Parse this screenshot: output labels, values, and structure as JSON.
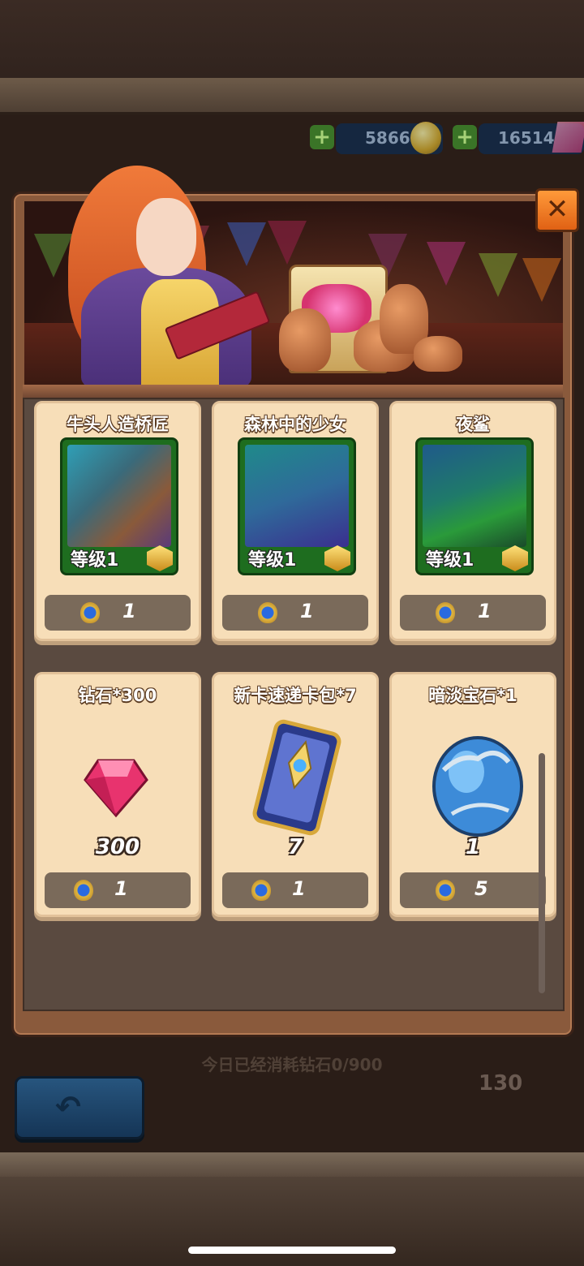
{
  "hud": {
    "gold": "5866",
    "gems": "16514"
  },
  "background": {
    "daily_info": "今日已经消耗钻石0/900",
    "count": "130"
  },
  "modal": {
    "close_label": "✕"
  },
  "shop_items": [
    {
      "title": "牛头人造桥匠",
      "kind": "hero",
      "level": "等级1",
      "price": "1",
      "art_colors": [
        "#2f9fb6",
        "#5a3a7a"
      ]
    },
    {
      "title": "森林中的少女",
      "kind": "hero",
      "level": "等级1",
      "price": "1",
      "art_colors": [
        "#1f8a8a",
        "#3a2f8f"
      ]
    },
    {
      "title": "夜鲨",
      "kind": "hero",
      "level": "等级1",
      "price": "1",
      "art_colors": [
        "#1f5a8a",
        "#2a7a4a"
      ]
    },
    {
      "title": "钻石*300",
      "kind": "item",
      "quantity": "300",
      "price": "1",
      "icon": "gem-icon"
    },
    {
      "title": "新卡速递卡包*7",
      "kind": "item",
      "quantity": "7",
      "price": "1",
      "icon": "card-pack-icon"
    },
    {
      "title": "暗淡宝石*1",
      "kind": "item",
      "quantity": "1",
      "price": "5",
      "icon": "egg-stone-icon"
    }
  ],
  "colors": {
    "card_bg": "#f7deb8",
    "price_bar": "#7a6a5a",
    "close_button": "#f07a22",
    "hero_frame": "#1e6d1f"
  }
}
